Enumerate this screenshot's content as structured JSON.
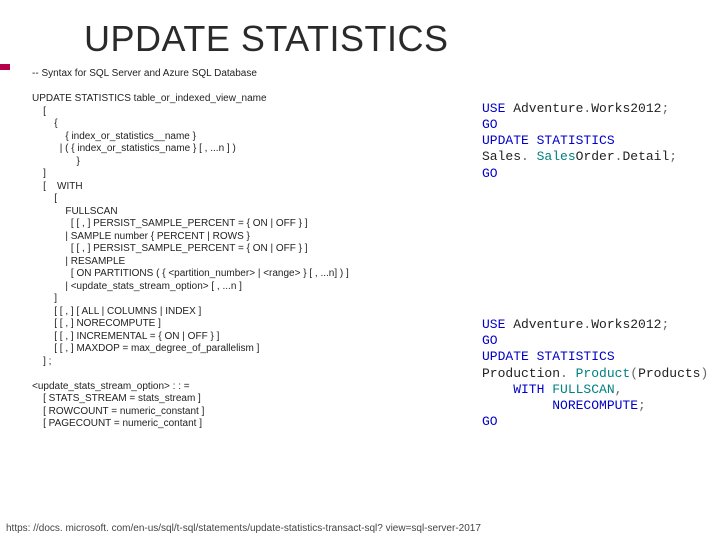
{
  "title": "UPDATE STATISTICS",
  "syntax": "-- Syntax for SQL Server and Azure SQL Database\n\nUPDATE STATISTICS table_or_indexed_view_name\n    [\n        {\n            { index_or_statistics__name }\n          | ( { index_or_statistics_name } [ , ...n ] )\n                }\n    ]\n    [    WITH\n        [\n            FULLSCAN\n              [ [ , ] PERSIST_SAMPLE_PERCENT = { ON | OFF } ]\n            | SAMPLE number { PERCENT | ROWS }\n              [ [ , ] PERSIST_SAMPLE_PERCENT = { ON | OFF } ]\n            | RESAMPLE\n              [ ON PARTITIONS ( { <partition_number> | <range> } [ , ...n] ) ]\n            | <update_stats_stream_option> [ , ...n ]\n        ]\n        [ [ , ] [ ALL | COLUMNS | INDEX ]\n        [ [ , ] NORECOMPUTE ]\n        [ [ , ] INCREMENTAL = { ON | OFF } ]\n        [ [ , ] MAXDOP = max_degree_of_parallelism ]\n    ] ;\n\n<update_stats_stream_option> : : =\n    [ STATS_STREAM = stats_stream ]\n    [ ROWCOUNT = numeric_constant ]\n    [ PAGECOUNT = numeric_contant ]",
  "example1": {
    "l1a": "USE",
    "l1b": " Adventure",
    "l1c": ".",
    "l1d": "Works",
    "l1e": "2012",
    "l1f": ";",
    "l2": "GO",
    "l3": "UPDATE STATISTICS",
    "l4a": "Sales",
    "l4b": ".",
    "l4c": " Sales",
    "l4d": "Order",
    "l4e": ".",
    "l4f": "Detail",
    "l4g": ";",
    "l5": "GO"
  },
  "example2": {
    "l1a": "USE",
    "l1b": " Adventure",
    "l1c": ".",
    "l1d": "Works",
    "l1e": "2012",
    "l1f": ";",
    "l2": "GO",
    "l3": "UPDATE STATISTICS",
    "l4a": "Production",
    "l4b": ".",
    "l4c": " Product",
    "l4d": "(",
    "l4e": "Products",
    "l4f": ")",
    "l5a": "    WITH",
    "l5b": " FULLSCAN",
    "l5c": ",",
    "l6a": "         NORECOMPUTE",
    "l6b": ";",
    "l7": "GO"
  },
  "footer_url": "https: //docs. microsoft. com/en-us/sql/t-sql/statements/update-statistics-transact-sql? view=sql-server-2017"
}
